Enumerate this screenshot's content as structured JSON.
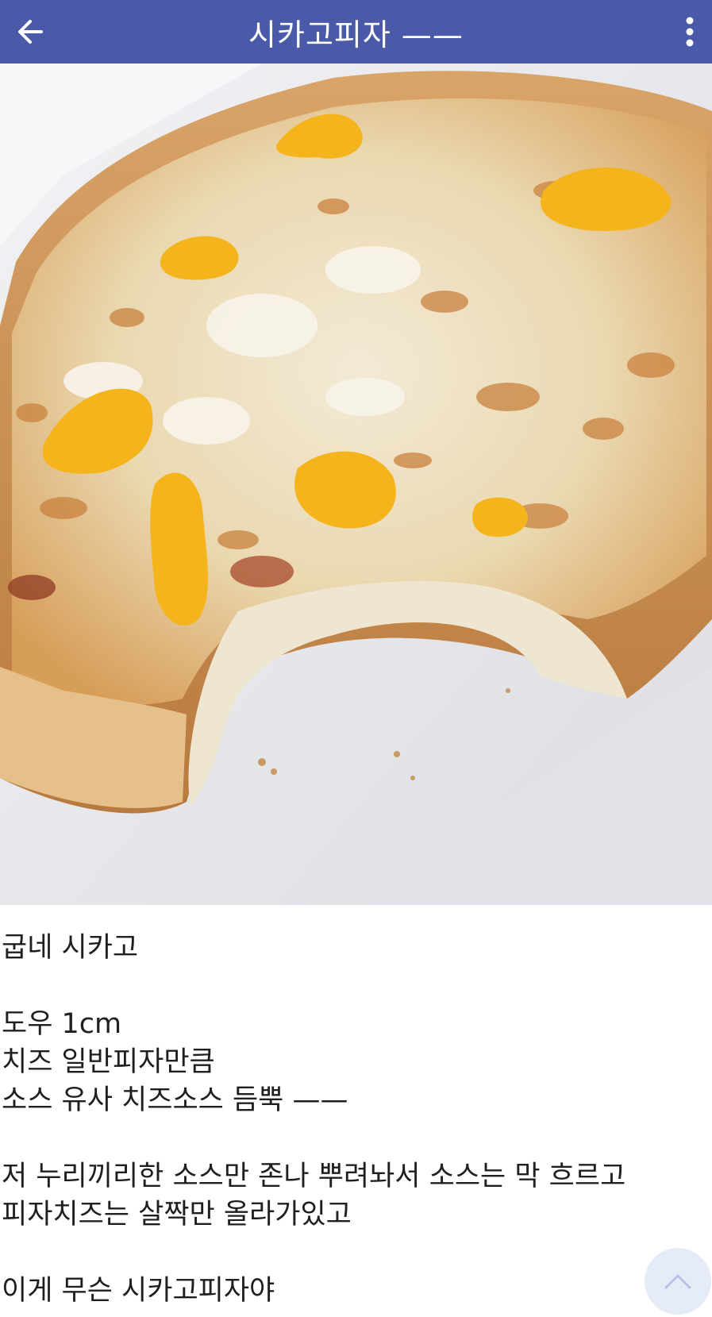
{
  "appbar": {
    "title": "시카고피자 ——",
    "back_icon": "arrow-left-icon",
    "menu_icon": "more-vertical-icon",
    "background": "#4a5aa9"
  },
  "post": {
    "image_icon": "pizza-photo",
    "lines": {
      "l1": "굽네 시카고",
      "l2": "도우 1cm",
      "l3": "치즈 일반피자만큼",
      "l4": "소스 유사 치즈소스 듬뿍 ——",
      "l5": "저 누리끼리한 소스만 존나 뿌려놔서 소스는 막 흐르고",
      "l6": "피자치즈는 살짝만 올라가있고",
      "l7": "이게 무슨 시카고피자야"
    }
  },
  "scroll_top_icon": "chevron-up-icon"
}
